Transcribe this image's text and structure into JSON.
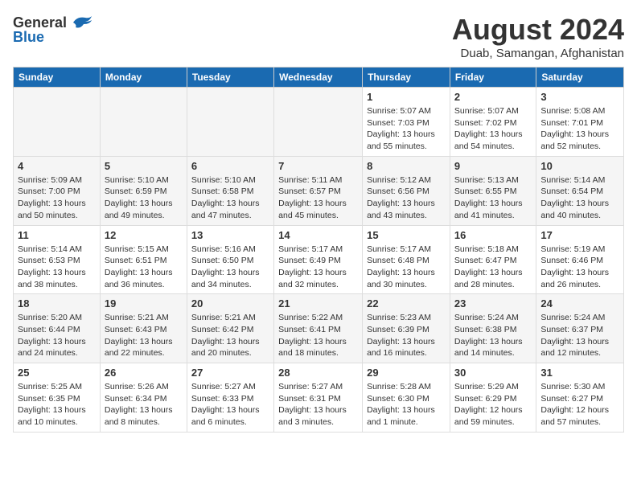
{
  "header": {
    "logo_general": "General",
    "logo_blue": "Blue",
    "month_year": "August 2024",
    "location": "Duab, Samangan, Afghanistan"
  },
  "weekdays": [
    "Sunday",
    "Monday",
    "Tuesday",
    "Wednesday",
    "Thursday",
    "Friday",
    "Saturday"
  ],
  "weeks": [
    [
      {
        "day": "",
        "info": ""
      },
      {
        "day": "",
        "info": ""
      },
      {
        "day": "",
        "info": ""
      },
      {
        "day": "",
        "info": ""
      },
      {
        "day": "1",
        "info": "Sunrise: 5:07 AM\nSunset: 7:03 PM\nDaylight: 13 hours\nand 55 minutes."
      },
      {
        "day": "2",
        "info": "Sunrise: 5:07 AM\nSunset: 7:02 PM\nDaylight: 13 hours\nand 54 minutes."
      },
      {
        "day": "3",
        "info": "Sunrise: 5:08 AM\nSunset: 7:01 PM\nDaylight: 13 hours\nand 52 minutes."
      }
    ],
    [
      {
        "day": "4",
        "info": "Sunrise: 5:09 AM\nSunset: 7:00 PM\nDaylight: 13 hours\nand 50 minutes."
      },
      {
        "day": "5",
        "info": "Sunrise: 5:10 AM\nSunset: 6:59 PM\nDaylight: 13 hours\nand 49 minutes."
      },
      {
        "day": "6",
        "info": "Sunrise: 5:10 AM\nSunset: 6:58 PM\nDaylight: 13 hours\nand 47 minutes."
      },
      {
        "day": "7",
        "info": "Sunrise: 5:11 AM\nSunset: 6:57 PM\nDaylight: 13 hours\nand 45 minutes."
      },
      {
        "day": "8",
        "info": "Sunrise: 5:12 AM\nSunset: 6:56 PM\nDaylight: 13 hours\nand 43 minutes."
      },
      {
        "day": "9",
        "info": "Sunrise: 5:13 AM\nSunset: 6:55 PM\nDaylight: 13 hours\nand 41 minutes."
      },
      {
        "day": "10",
        "info": "Sunrise: 5:14 AM\nSunset: 6:54 PM\nDaylight: 13 hours\nand 40 minutes."
      }
    ],
    [
      {
        "day": "11",
        "info": "Sunrise: 5:14 AM\nSunset: 6:53 PM\nDaylight: 13 hours\nand 38 minutes."
      },
      {
        "day": "12",
        "info": "Sunrise: 5:15 AM\nSunset: 6:51 PM\nDaylight: 13 hours\nand 36 minutes."
      },
      {
        "day": "13",
        "info": "Sunrise: 5:16 AM\nSunset: 6:50 PM\nDaylight: 13 hours\nand 34 minutes."
      },
      {
        "day": "14",
        "info": "Sunrise: 5:17 AM\nSunset: 6:49 PM\nDaylight: 13 hours\nand 32 minutes."
      },
      {
        "day": "15",
        "info": "Sunrise: 5:17 AM\nSunset: 6:48 PM\nDaylight: 13 hours\nand 30 minutes."
      },
      {
        "day": "16",
        "info": "Sunrise: 5:18 AM\nSunset: 6:47 PM\nDaylight: 13 hours\nand 28 minutes."
      },
      {
        "day": "17",
        "info": "Sunrise: 5:19 AM\nSunset: 6:46 PM\nDaylight: 13 hours\nand 26 minutes."
      }
    ],
    [
      {
        "day": "18",
        "info": "Sunrise: 5:20 AM\nSunset: 6:44 PM\nDaylight: 13 hours\nand 24 minutes."
      },
      {
        "day": "19",
        "info": "Sunrise: 5:21 AM\nSunset: 6:43 PM\nDaylight: 13 hours\nand 22 minutes."
      },
      {
        "day": "20",
        "info": "Sunrise: 5:21 AM\nSunset: 6:42 PM\nDaylight: 13 hours\nand 20 minutes."
      },
      {
        "day": "21",
        "info": "Sunrise: 5:22 AM\nSunset: 6:41 PM\nDaylight: 13 hours\nand 18 minutes."
      },
      {
        "day": "22",
        "info": "Sunrise: 5:23 AM\nSunset: 6:39 PM\nDaylight: 13 hours\nand 16 minutes."
      },
      {
        "day": "23",
        "info": "Sunrise: 5:24 AM\nSunset: 6:38 PM\nDaylight: 13 hours\nand 14 minutes."
      },
      {
        "day": "24",
        "info": "Sunrise: 5:24 AM\nSunset: 6:37 PM\nDaylight: 13 hours\nand 12 minutes."
      }
    ],
    [
      {
        "day": "25",
        "info": "Sunrise: 5:25 AM\nSunset: 6:35 PM\nDaylight: 13 hours\nand 10 minutes."
      },
      {
        "day": "26",
        "info": "Sunrise: 5:26 AM\nSunset: 6:34 PM\nDaylight: 13 hours\nand 8 minutes."
      },
      {
        "day": "27",
        "info": "Sunrise: 5:27 AM\nSunset: 6:33 PM\nDaylight: 13 hours\nand 6 minutes."
      },
      {
        "day": "28",
        "info": "Sunrise: 5:27 AM\nSunset: 6:31 PM\nDaylight: 13 hours\nand 3 minutes."
      },
      {
        "day": "29",
        "info": "Sunrise: 5:28 AM\nSunset: 6:30 PM\nDaylight: 13 hours\nand 1 minute."
      },
      {
        "day": "30",
        "info": "Sunrise: 5:29 AM\nSunset: 6:29 PM\nDaylight: 12 hours\nand 59 minutes."
      },
      {
        "day": "31",
        "info": "Sunrise: 5:30 AM\nSunset: 6:27 PM\nDaylight: 12 hours\nand 57 minutes."
      }
    ]
  ]
}
